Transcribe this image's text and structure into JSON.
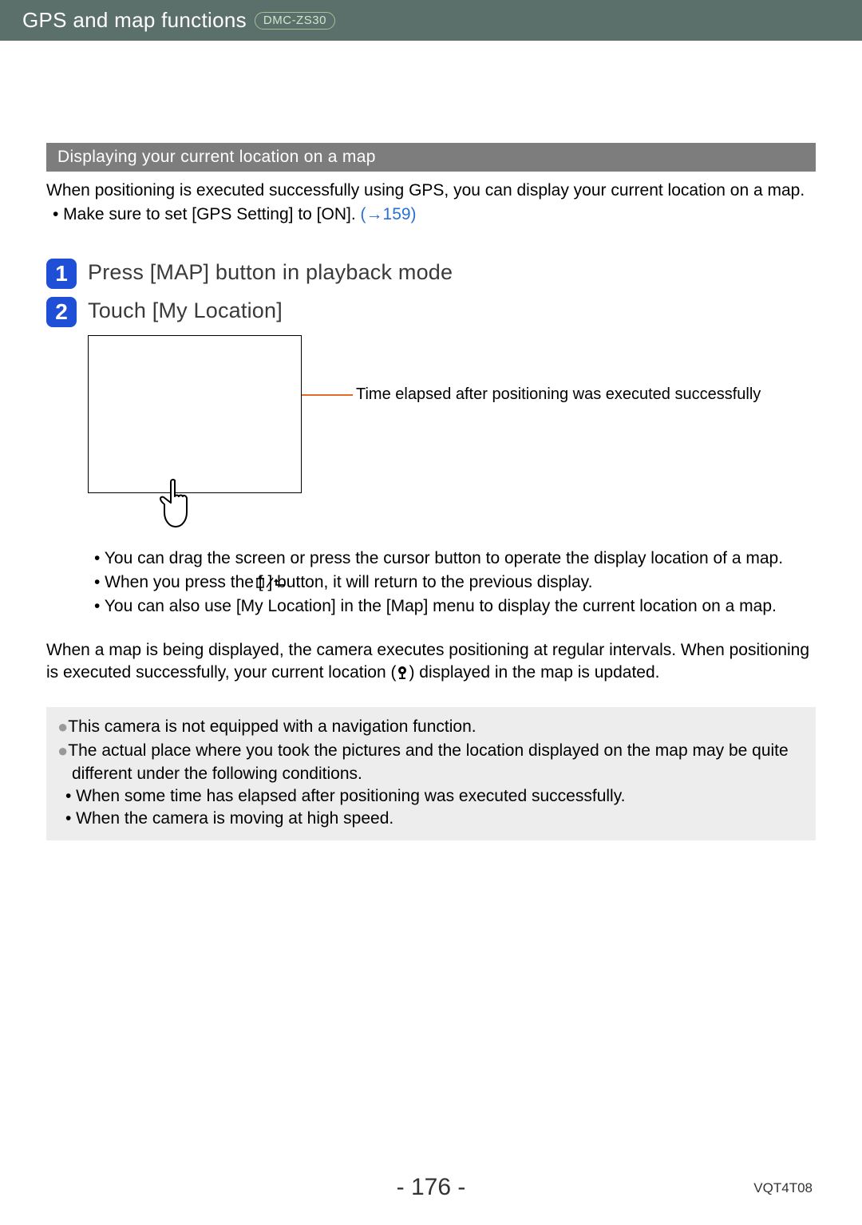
{
  "header": {
    "title": "GPS and map functions",
    "model": "DMC-ZS30"
  },
  "section_title": "Displaying your current location on a map",
  "intro": "When positioning is executed successfully using GPS, you can display your current location on a map.",
  "intro_bullet_prefix": " • Make sure to set [GPS Setting] to [ON]. ",
  "intro_bullet_link": "(→159)",
  "steps": [
    {
      "num": "1",
      "text": "Press [MAP] button in playback mode"
    },
    {
      "num": "2",
      "text": "Touch [My Location]"
    }
  ],
  "callout": "Time elapsed after positioning was executed successfully",
  "sub_bullets": [
    "• You can drag the screen or press the cursor button to operate the display location of a map.",
    "• When you press the [       ] button, it will return to the previous display.",
    "• You can also use [My Location] in the [Map] menu to display the current location on a map."
  ],
  "para2_a": "When a map is being displayed, the camera executes positioning at regular intervals. When positioning is executed successfully, your current location (",
  "para2_b": ") displayed in the map is updated.",
  "notes": {
    "n1": "This camera is not equipped with a navigation function.",
    "n2": "The actual place where you took the pictures and the location displayed on the map may be quite different under the following conditions.",
    "n2a": "• When some time has elapsed after positioning was executed successfully.",
    "n2b": "• When the camera is moving at high speed."
  },
  "page_number": "- 176 -",
  "doc_code": "VQT4T08"
}
